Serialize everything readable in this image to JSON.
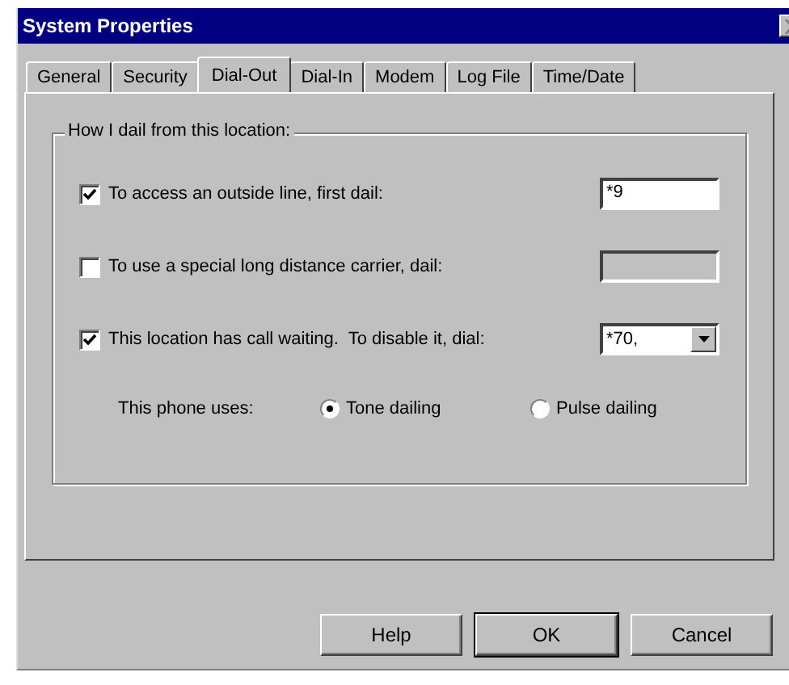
{
  "window": {
    "title": "System Properties"
  },
  "tabs": [
    {
      "label": "General",
      "selected": false
    },
    {
      "label": "Security",
      "selected": false
    },
    {
      "label": "Dial-Out",
      "selected": true
    },
    {
      "label": "Dial-In",
      "selected": false
    },
    {
      "label": "Modem",
      "selected": false
    },
    {
      "label": "Log File",
      "selected": false
    },
    {
      "label": "Time/Date",
      "selected": false
    }
  ],
  "group": {
    "title": "How I dail from this location:",
    "options": [
      {
        "kind": "field",
        "label": "To access an outside line, first dail:",
        "checked": true,
        "value": "*9",
        "disabled": false
      },
      {
        "kind": "field",
        "label": "To use a special long distance carrier, dail:",
        "checked": false,
        "disabled": true
      },
      {
        "kind": "combo",
        "label": "This location has call waiting.  To disable it, dial:",
        "checked": true,
        "value": "*70,",
        "disabled": false
      }
    ],
    "phone": {
      "label": "This phone uses:",
      "radios": [
        {
          "label": "Tone dailing",
          "selected": true
        },
        {
          "label": "Pulse dailing",
          "selected": false
        }
      ]
    }
  },
  "buttons": [
    {
      "label": "Help",
      "default": false
    },
    {
      "label": "OK",
      "default": true
    },
    {
      "label": "Cancel",
      "default": false
    }
  ]
}
